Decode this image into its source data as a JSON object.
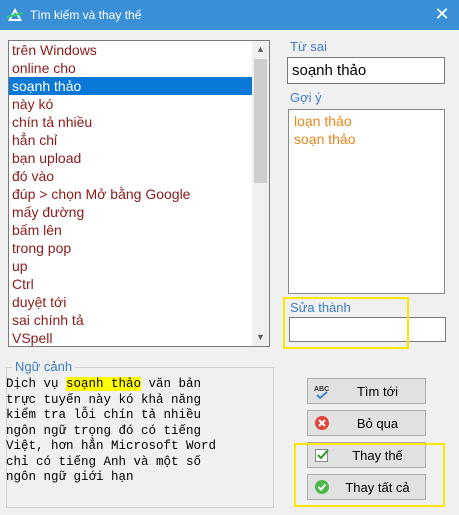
{
  "window": {
    "title": "Tìm kiếm và thay thế",
    "close_label": "✕"
  },
  "wordlist": {
    "selected_index": 2,
    "items": [
      "trên Windows",
      "online cho",
      "soạnh thảo",
      "này kó",
      "chín tả nhiều",
      "hẳn chỉ",
      "bạn upload",
      "đó vào",
      "đúp > chọn Mở bằng Google",
      "mấy đường",
      "bấm lên",
      "trong pop",
      "up",
      "Ctrl",
      "duyệt tới",
      "sai chính tả",
      "VSpell"
    ]
  },
  "misspelled": {
    "label": "Từ sai",
    "value": "soạnh thảo"
  },
  "suggestions": {
    "label": "Gợi ý",
    "items": [
      "loạn thảo",
      "soạn thảo"
    ]
  },
  "correction": {
    "label": "Sửa thành",
    "value": ""
  },
  "context": {
    "label": "Ngữ cảnh",
    "before": "Dịch vụ ",
    "highlight": "soạnh thảo",
    "after": " văn bản trực tuyến này kó khả năng kiểm tra lỗi chín tả nhiều ngôn ngữ trọng đó có tiếng Việt, hơn hẳn Microsoft Word chỉ có tiếng Anh và một số ngôn ngữ giới hạn",
    "lines": [
      "Dịch vụ ",
      "trực tuyến này kó khả năng",
      "kiểm tra lỗi chín tả nhiều",
      "ngôn ngữ trọng đó có tiếng",
      "Việt, hơn hẳn Microsoft Word",
      "chỉ có tiếng Anh và một số",
      "ngôn ngữ giới hạn"
    ],
    "line1_tail": " văn bản"
  },
  "buttons": {
    "find_next": "Tìm tới",
    "ignore": "Bỏ qua",
    "replace": "Thay thế",
    "replace_all": "Thay tất cả"
  },
  "icons": {
    "app": "app-logo-icon",
    "find_next": "spellcheck-icon",
    "ignore": "cancel-icon",
    "replace": "checkbox-check-icon",
    "replace_all": "green-check-icon"
  },
  "colors": {
    "titlebar": "#3a8fd6",
    "selection": "#0a78d7",
    "word_text": "#8b1a1a",
    "suggestion_text": "#e8861a",
    "highlight": "#ffff00",
    "annotation": "#ffe600"
  }
}
